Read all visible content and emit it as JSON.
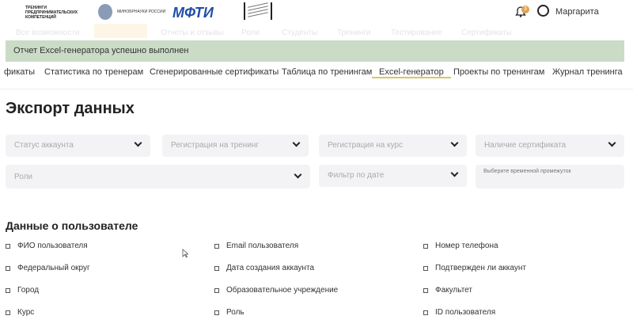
{
  "header": {
    "logo_text": "ТРЕНИНГИ ПРЕДПРИНИМАТЕЛЬСКИХ КОМПЕТЕНЦИЙ",
    "ministry": "МИНОБРНАУКИ РОССИИ",
    "mfti": "МФТИ",
    "notifications": "3",
    "user": "Маргарита"
  },
  "background_nav": [
    "Все возможности",
    "Отчеты и отзывы",
    "Роли",
    "Студенты",
    "Тренинги",
    "Тестирование",
    "Сертификаты"
  ],
  "toast": "Отчет Excel-генератора успешно выполнен",
  "tabs": [
    "фикаты",
    "Статистика по тренерам",
    "Сгенерированные сертификаты",
    "Таблица по тренингам",
    "Excel-генератор",
    "Проекты по тренингам",
    "Журнал тренинга"
  ],
  "title": "Экспорт данных",
  "filters": {
    "status": "Статус аккаунта",
    "training_reg": "Регистрация на тренинг",
    "course_reg": "Регистрация на курс",
    "certificate": "Наличие сертификата",
    "roles": "Роли",
    "date_filter": "Фильтр по дате",
    "period": "Выберите временной промежуток"
  },
  "section": "Данные о пользователе",
  "fields": [
    "ФИО пользователя",
    "Email пользователя",
    "Номер телефона",
    "Федеральный округ",
    "Дата создания аккаунта",
    "Подтвержден ли аккаунт",
    "Город",
    "Образовательное учреждение",
    "Факультет",
    "Курс",
    "Роль",
    "ID пользователя"
  ]
}
